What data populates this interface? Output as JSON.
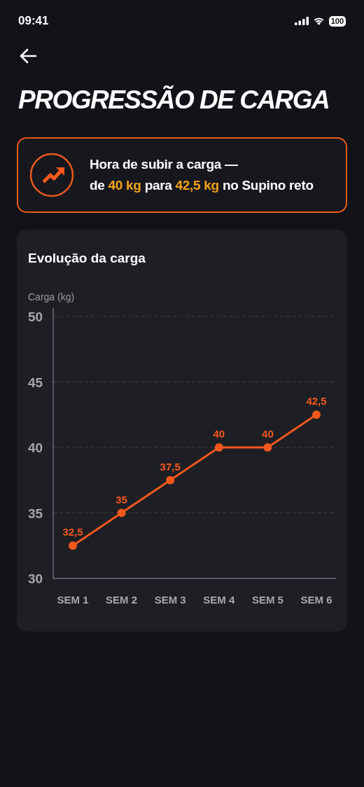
{
  "status_bar": {
    "time": "09:41",
    "battery": "100"
  },
  "title": "PROGRESSÃO DE CARGA",
  "alert": {
    "line_1": "Hora de subir a carga —",
    "line_2": "de **40 kg** para **42,5 kg** no Supino reto"
  },
  "chart_card": {
    "chart_data": {
      "type": "line",
      "title": "Evolução da carga",
      "ylabel": "Carga (kg)",
      "categories": [
        "SEM 1",
        "SEM 2",
        "SEM 3",
        "SEM 4",
        "SEM 5",
        "SEM 6"
      ],
      "series": [
        {
          "color": "#f4581c",
          "marker": "circle",
          "values": [
            32.5,
            35,
            37.5,
            40,
            40,
            42.5
          ]
        }
      ],
      "ylim": [
        30,
        50
      ],
      "yticks": [
        30,
        35,
        40,
        45,
        50
      ],
      "grid": true,
      "value_labels": [
        "32,5",
        "35",
        "37,5",
        "40",
        "40",
        "42,5"
      ]
    }
  }
}
